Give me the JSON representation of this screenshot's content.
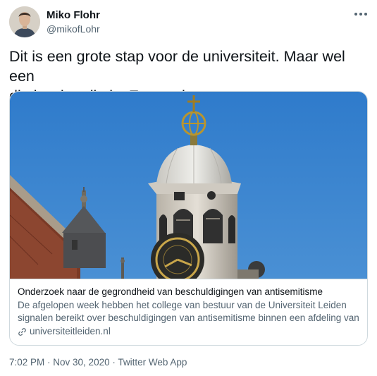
{
  "author": {
    "name": "Miko Flohr",
    "handle": "@mikofLohr"
  },
  "tweet": {
    "text_line1": "Dit is een grote stap voor de universiteit. Maar wel een",
    "text_line2": "die hard nodig is. En goed."
  },
  "card": {
    "title": "Onderzoek naar de gegrondheid van beschuldigingen van antisemitisme",
    "description_line1": "De afgelopen week hebben het college van bestuur van de Universiteit Leiden",
    "description_line2": "signalen bereikt over beschuldigingen van antisemitisme binnen een afdeling van ...",
    "domain": "universiteitleiden.nl"
  },
  "meta": {
    "time": "7:02 PM",
    "separator1": " · ",
    "date": "Nov 30, 2020",
    "separator2": " · ",
    "source": "Twitter Web App"
  },
  "colors": {
    "sky": "#3c85cf",
    "secondary_text": "#536471",
    "border": "#cfd9de"
  }
}
